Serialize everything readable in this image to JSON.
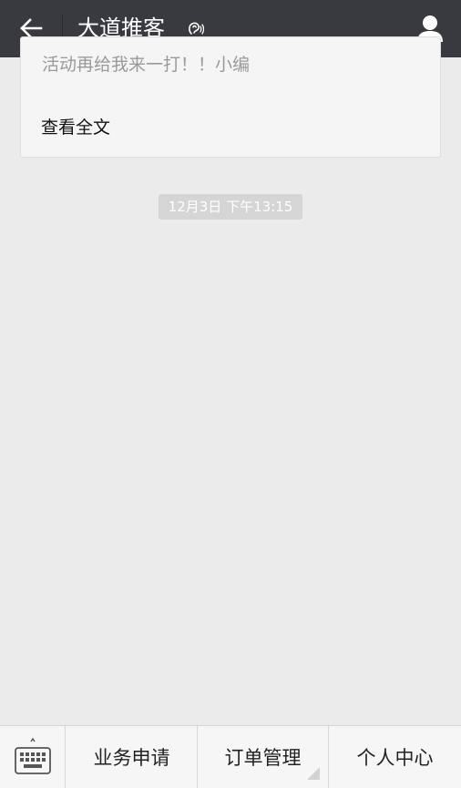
{
  "header": {
    "title": "大道推客",
    "icons": [
      "back-arrow-icon",
      "ear-icon",
      "user-profile-icon"
    ]
  },
  "message": {
    "excerpt": "活动再给我来一打！！小编",
    "read_more": "查看全文"
  },
  "timestamp": "12月3日 下午13:15",
  "bottom_menu": {
    "keyboard_icon": "keyboard-icon",
    "items": [
      {
        "label": "业务申请"
      },
      {
        "label": "订单管理"
      },
      {
        "label": "个人中心"
      }
    ]
  },
  "colors": {
    "header_bg": "#393a3f",
    "page_bg": "#ebebeb",
    "bottom_bar_bg": "#f6f6f6"
  }
}
